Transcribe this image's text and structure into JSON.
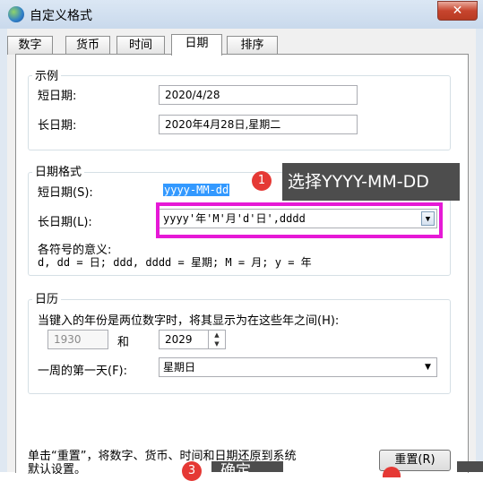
{
  "window": {
    "title": "自定义格式",
    "close_glyph": "✕"
  },
  "tabs": [
    {
      "label": "数字"
    },
    {
      "label": "货币"
    },
    {
      "label": "时间"
    },
    {
      "label": "日期",
      "active": true
    },
    {
      "label": "排序"
    }
  ],
  "example": {
    "title": "示例",
    "short_label": "短日期:",
    "short_value": "2020/4/28",
    "long_label": "长日期:",
    "long_value": "2020年4月28日,星期二"
  },
  "format": {
    "title": "日期格式",
    "short_label": "短日期(S):",
    "short_value": "yyyy-MM-dd",
    "long_label": "长日期(L):",
    "long_value": "yyyy'年'M'月'd'日',dddd",
    "meaning_title": "各符号的意义:",
    "meaning_text": "d, dd = 日; ddd, dddd = 星期; M = 月; y = 年"
  },
  "annotation": {
    "step1_number": "1",
    "step1_text": "选择YYYY-MM-DD",
    "step3_number": "3",
    "step3_text": "确定",
    "highlight_color": "#e619d6",
    "badge_color": "#e53935"
  },
  "calendar": {
    "title": "日历",
    "two_digit_text": "当键入的年份是两位数字时，将其显示为在这些年之间(H):",
    "year_from": "1930",
    "and_label": "和",
    "year_to": "2029",
    "first_day_label": "一周的第一天(F):",
    "first_day_value": "星期日"
  },
  "footer": {
    "reset_text_line1": "单击“重置”，将数字、货币、时间和日期还原到系统",
    "reset_text_line2": "默认设置。",
    "reset_button": "重置(R)"
  }
}
